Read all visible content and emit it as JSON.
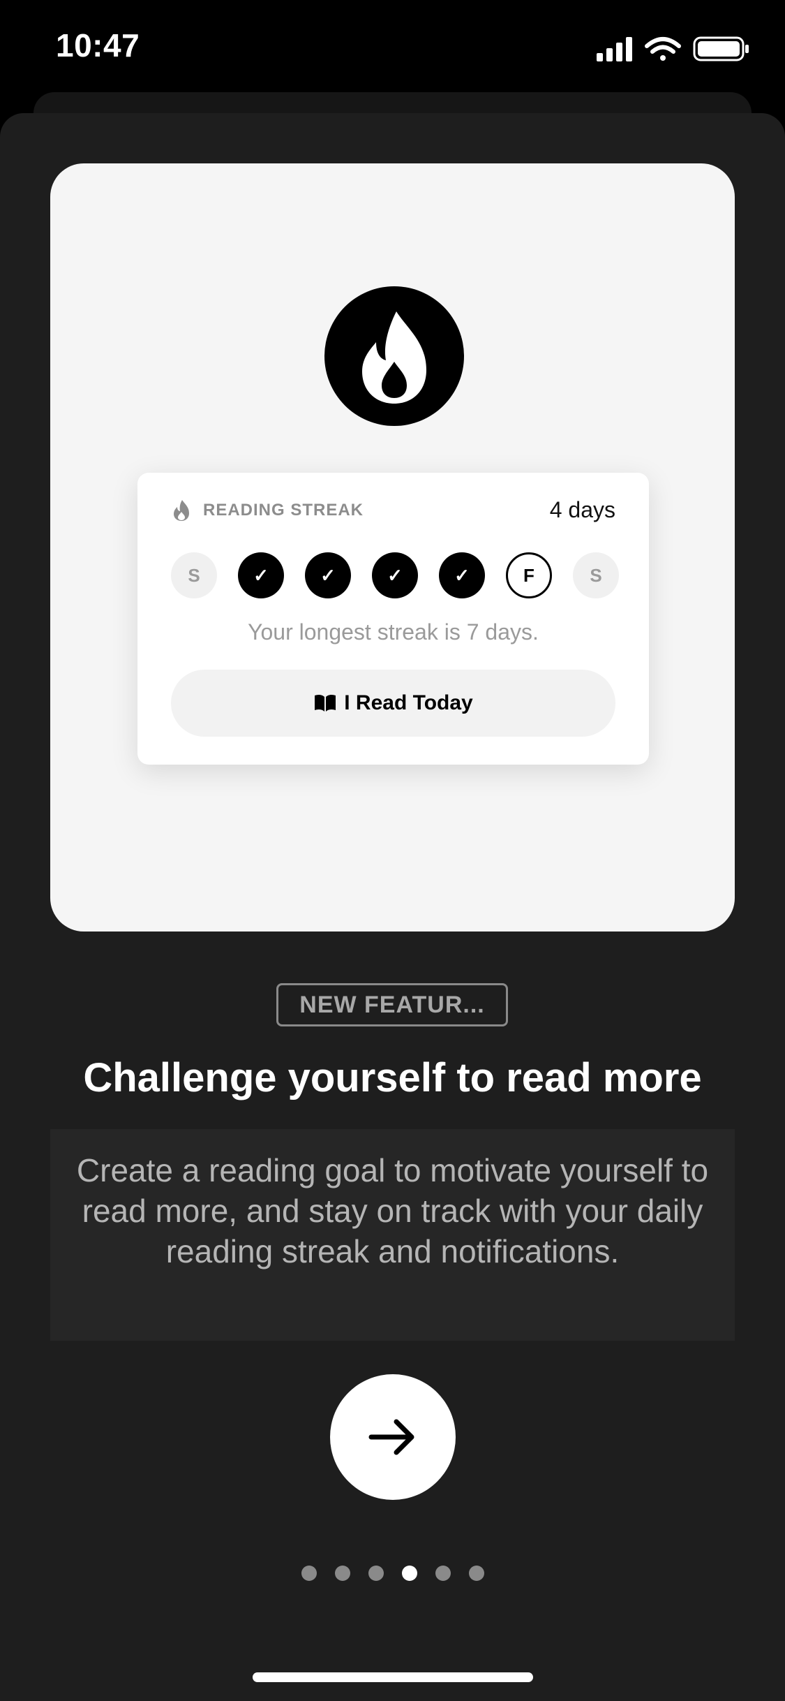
{
  "status_bar": {
    "time": "10:47",
    "icons": [
      "signal-icon",
      "wifi-icon",
      "battery-icon"
    ]
  },
  "hero": {
    "icon": "flame-icon",
    "streak_card": {
      "label": "READING STREAK",
      "days_count": "4 days",
      "week": [
        {
          "label": "S",
          "state": "off"
        },
        {
          "label": "✓",
          "state": "done"
        },
        {
          "label": "✓",
          "state": "done"
        },
        {
          "label": "✓",
          "state": "done"
        },
        {
          "label": "✓",
          "state": "done"
        },
        {
          "label": "F",
          "state": "today"
        },
        {
          "label": "S",
          "state": "off"
        }
      ],
      "longest_streak_text": "Your longest streak is 7 days.",
      "read_button_label": "I Read Today"
    }
  },
  "badge": "NEW FEATUR...",
  "title": "Challenge yourself to read more",
  "description": "Create a reading goal to motivate yourself to read more, and stay on track with your daily reading streak and notifications.",
  "next_button": {
    "icon": "arrow-right-icon"
  },
  "pagination": {
    "total": 6,
    "active_index": 3
  },
  "colors": {
    "background": "#1e1e1e",
    "card": "#f5f5f5",
    "accent": "#000000",
    "text_primary": "#ffffff",
    "text_secondary": "#b5b5b5"
  }
}
